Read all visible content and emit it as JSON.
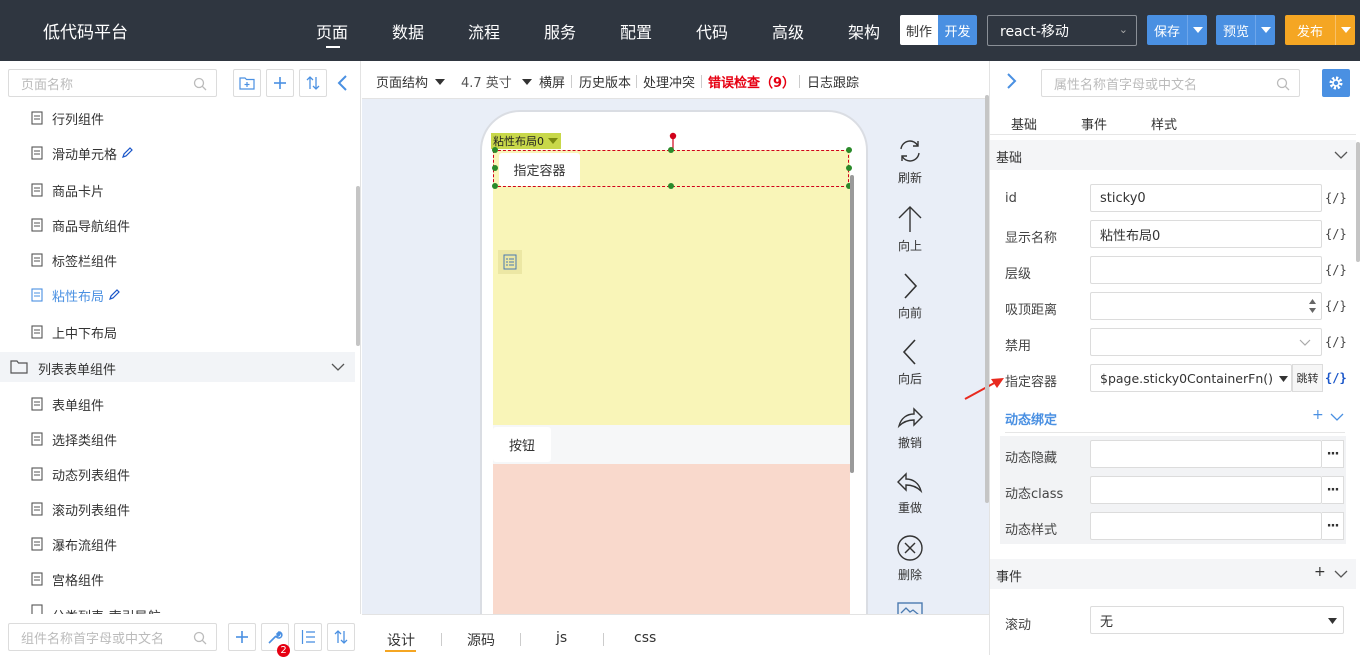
{
  "app": {
    "title": "低代码平台"
  },
  "topnav": {
    "items": [
      "页面",
      "数据",
      "流程",
      "服务",
      "配置",
      "代码",
      "高级",
      "架构"
    ],
    "mode_make": "制作",
    "mode_dev": "开发",
    "framework": "react-移动",
    "save": "保存",
    "preview": "预览",
    "publish": "发布"
  },
  "colors": {
    "topbar": "#2f3640",
    "accent": "#4a90e2",
    "publish": "#f5a623",
    "error": "#e60012"
  },
  "left": {
    "search_placeholder": "页面名称",
    "items": [
      "行列组件",
      "滑动单元格",
      "商品卡片",
      "商品导航组件",
      "标签栏组件",
      "粘性布局",
      "上中下布局"
    ],
    "group": "列表表单组件",
    "group_items": [
      "表单组件",
      "选择类组件",
      "动态列表组件",
      "滚动列表组件",
      "瀑布流组件",
      "宫格组件",
      "分类列表-索引导航"
    ],
    "comp_search_placeholder": "组件名称首字母或中文名",
    "badge": "2"
  },
  "toolbar": {
    "structure": "页面结构",
    "device": "4.7 英寸",
    "landscape": "横屏",
    "history": "历史版本",
    "conflict": "处理冲突",
    "errors": "错误检查（9）",
    "log": "日志跟踪"
  },
  "canvas": {
    "sticky_tag": "粘性布局0",
    "container": "指定容器",
    "button": "按钮"
  },
  "side_tools": [
    "刷新",
    "向上",
    "向前",
    "向后",
    "撤销",
    "重做",
    "删除"
  ],
  "bottom_tabs": [
    "设计",
    "源码",
    "js",
    "css"
  ],
  "right": {
    "search_placeholder": "属性名称首字母或中文名",
    "tabs": [
      "基础",
      "事件",
      "样式"
    ],
    "section_basic": "基础",
    "props": [
      {
        "label": "id",
        "value": ""
      },
      {
        "label": "显示名称",
        "value": ""
      },
      {
        "label": "层级",
        "value": ""
      },
      {
        "label": "吸顶距离",
        "value": ""
      },
      {
        "label": "禁用",
        "value": ""
      },
      {
        "label": "指定容器",
        "value": ""
      }
    ],
    "prop_values": {
      "id": "sticky0",
      "name": "粘性布局0",
      "container": "$page.sticky0ContainerFn()"
    },
    "curly": "{/}",
    "jump": "跳转",
    "dynamic_bind": "动态绑定",
    "dyn": [
      "动态隐藏",
      "动态class",
      "动态样式"
    ],
    "section_events": "事件",
    "scroll_label": "滚动",
    "scroll_value": "无",
    "plus": "+"
  }
}
